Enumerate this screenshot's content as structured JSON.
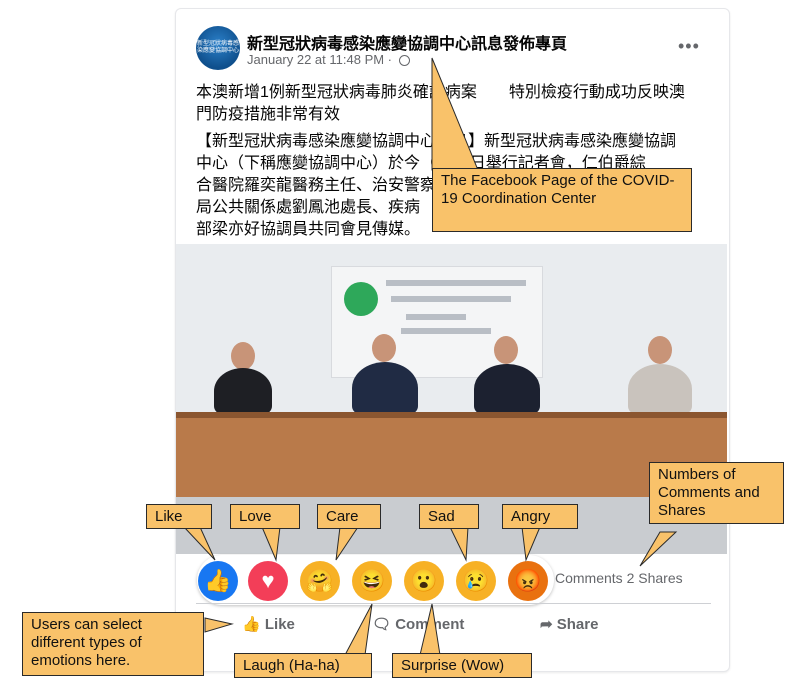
{
  "post": {
    "page_name": "新型冠狀病毒感染應變協調中心訊息發佈專頁",
    "timestamp": "January 22 at 11:48 PM · ",
    "more": "•••",
    "line1": "本澳新增1例新型冠狀病毒肺炎確診病案　　特別檢疫行動成功反映澳",
    "line2": "門防疫措施非常有效",
    "body1": "【新型冠狀病毒感染應變協調中心消息】新型冠狀病毒感染應變協調",
    "body2": "中心（下稱應變協調中心）於今（22）日舉行記者會，仁伯爵綜",
    "body3": "合醫院羅奕龍醫務主任、治安警察局",
    "body4": "局公共關係處劉鳳池處長、疾病",
    "body5": "部梁亦好協調員共同會見傳媒。",
    "avatar_text": "新型冠狀病毒感染應變協調中心"
  },
  "engagement": {
    "counts": "Comments  2 Shares"
  },
  "actions": {
    "like": "Like",
    "comment": "Comment",
    "share": "Share"
  },
  "reactions": [
    {
      "name": "like-icon",
      "glyph": "👍",
      "color": "#1877f2"
    },
    {
      "name": "love-icon",
      "glyph": "♥",
      "color": "#f33e58"
    },
    {
      "name": "care-icon",
      "glyph": "🤗",
      "color": "#f7b125"
    },
    {
      "name": "haha-icon",
      "glyph": "😆",
      "color": "#f7b125"
    },
    {
      "name": "wow-icon",
      "glyph": "😮",
      "color": "#f7b125"
    },
    {
      "name": "sad-icon",
      "glyph": "😢",
      "color": "#f7b125"
    },
    {
      "name": "angry-icon",
      "glyph": "😡",
      "color": "#e9710f"
    }
  ],
  "callouts": {
    "page": "The Facebook Page of the COVID-19 Coordination Center",
    "numbers": "Numbers of Comments and Shares",
    "like": "Like",
    "love": "Love",
    "care": "Care",
    "sad": "Sad",
    "angry": "Angry",
    "select": "Users can select different types of emotions here.",
    "laugh": "Laugh (Ha-ha)",
    "surprise": "Surprise (Wow)"
  }
}
